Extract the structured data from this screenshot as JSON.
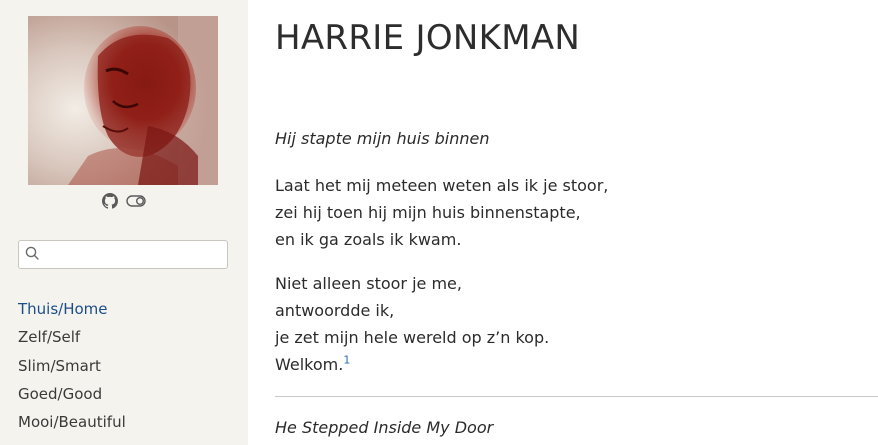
{
  "sidebar": {
    "github_icon": "github-icon",
    "theme_toggle_icon": "toggle-icon",
    "search": {
      "placeholder": "",
      "icon": "search-icon"
    },
    "nav": [
      {
        "label": "Thuis/Home",
        "active": true
      },
      {
        "label": "Zelf/Self",
        "active": false
      },
      {
        "label": "Slim/Smart",
        "active": false
      },
      {
        "label": "Goed/Good",
        "active": false
      },
      {
        "label": "Mooi/Beautiful",
        "active": false
      }
    ]
  },
  "main": {
    "site_title": "HARRIE JONKMAN",
    "poem_title_nl": "Hij stapte mijn huis binnen",
    "stanza1": [
      "Laat het mij meteen weten als ik je stoor,",
      "zei hij toen hij mijn huis binnenstapte,",
      "en ik ga zoals ik kwam."
    ],
    "stanza2": [
      "Niet alleen stoor je me,",
      "antwoordde ik,",
      "je zet mijn hele wereld op z’n kop.",
      "Welkom."
    ],
    "footnote_ref": "1",
    "poem_title_en": "He Stepped Inside My Door"
  },
  "colors": {
    "sidebar_bg": "#f5f3ee",
    "active_link": "#1a4e8a",
    "footnote_link": "#2a6ab8"
  }
}
